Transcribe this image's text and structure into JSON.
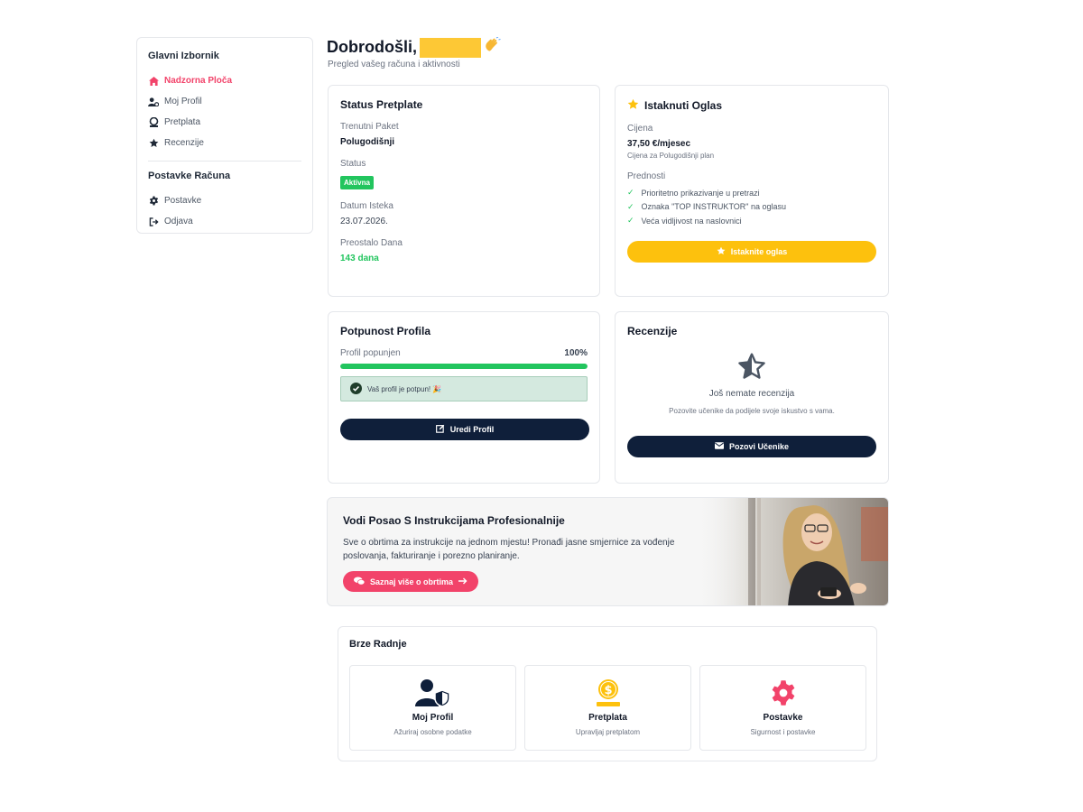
{
  "sidebar": {
    "main_heading": "Glavni Izbornik",
    "main_items": [
      {
        "label": "Nadzorna Ploča",
        "icon": "home-icon"
      },
      {
        "label": "Moj Profil",
        "icon": "user-gear-icon"
      },
      {
        "label": "Pretplata",
        "icon": "subscription-icon"
      },
      {
        "label": "Recenzije",
        "icon": "star-icon"
      }
    ],
    "account_heading": "Postavke Računa",
    "account_items": [
      {
        "label": "Postavke",
        "icon": "gear-icon"
      },
      {
        "label": "Odjava",
        "icon": "logout-icon"
      }
    ]
  },
  "header": {
    "greeting": "Dobrodošli,",
    "subtitle": "Pregled vašeg računa i aktivnosti"
  },
  "subscription": {
    "title": "Status Pretplate",
    "package_label": "Trenutni Paket",
    "package_value": "Polugodišnji",
    "status_label": "Status",
    "status_badge": "Aktivna",
    "expiry_label": "Datum Isteka",
    "expiry_value": "23.07.2026.",
    "remaining_label": "Preostalo Dana",
    "remaining_value": "143 dana"
  },
  "featured": {
    "title": "Istaknuti Oglas",
    "price_label": "Cijena",
    "price_value": "37,50 €/mjesec",
    "price_note": "Cijena za Polugodišnji plan",
    "benefits_label": "Prednosti",
    "benefits": [
      "Prioritetno prikazivanje u pretrazi",
      "Oznaka \"TOP INSTRUKTOR\" na oglasu",
      "Veća vidljivost na naslovnici"
    ],
    "button": "Istaknite oglas"
  },
  "profile": {
    "title": "Potpunost Profila",
    "progress_label": "Profil popunjen",
    "progress_text": "100%",
    "progress_fraction": 1.0,
    "complete_msg": "Vaš profil je potpun! 🎉",
    "button": "Uredi Profil"
  },
  "reviews": {
    "title": "Recenzije",
    "empty_title": "Još nemate recenzija",
    "empty_desc": "Pozovite učenike da podijele svoje iskustvo s vama.",
    "button": "Pozovi Učenike"
  },
  "banner": {
    "title": "Vodi Posao S Instrukcijama Profesionalnije",
    "description": "Sve o obrtima za instrukcije na jednom mjestu! Pronađi jasne smjernice za vođenje poslovanja, fakturiranje i porezno planiranje.",
    "button": "Saznaj više o obrtima"
  },
  "quick_actions": {
    "title": "Brze Radnje",
    "items": [
      {
        "title": "Moj Profil",
        "desc": "Ažuriraj osobne podatke",
        "icon": "user-shield-icon"
      },
      {
        "title": "Pretplata",
        "desc": "Upravljaj pretplatom",
        "icon": "coin-hand-icon"
      },
      {
        "title": "Postavke",
        "desc": "Sigurnost i postavke",
        "icon": "gear-icon"
      }
    ]
  },
  "colors": {
    "accent_pink": "#f2436a",
    "accent_yellow": "#fdc10d",
    "navy": "#0f1f3a",
    "success": "#22c55e"
  }
}
